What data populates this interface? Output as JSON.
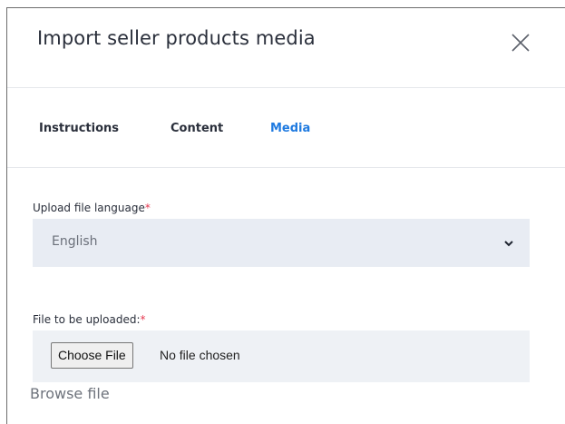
{
  "modal": {
    "title": "Import seller products media"
  },
  "tabs": [
    {
      "label": "Instructions",
      "active": false
    },
    {
      "label": "Content",
      "active": false
    },
    {
      "label": "Media",
      "active": true
    }
  ],
  "form": {
    "language_label": "Upload file language",
    "language_required": "*",
    "language_value": "English",
    "file_label": "File to be uploaded:",
    "file_required": "*",
    "choose_file_label": "Choose File",
    "no_file_text": "No file chosen",
    "browse_text": "Browse file"
  },
  "colors": {
    "accent": "#1f7ae0",
    "required": "#e53950",
    "select_bg": "#e8ecf3"
  },
  "icons": {
    "close": "close-icon",
    "chevron": "chevron-down-icon"
  }
}
